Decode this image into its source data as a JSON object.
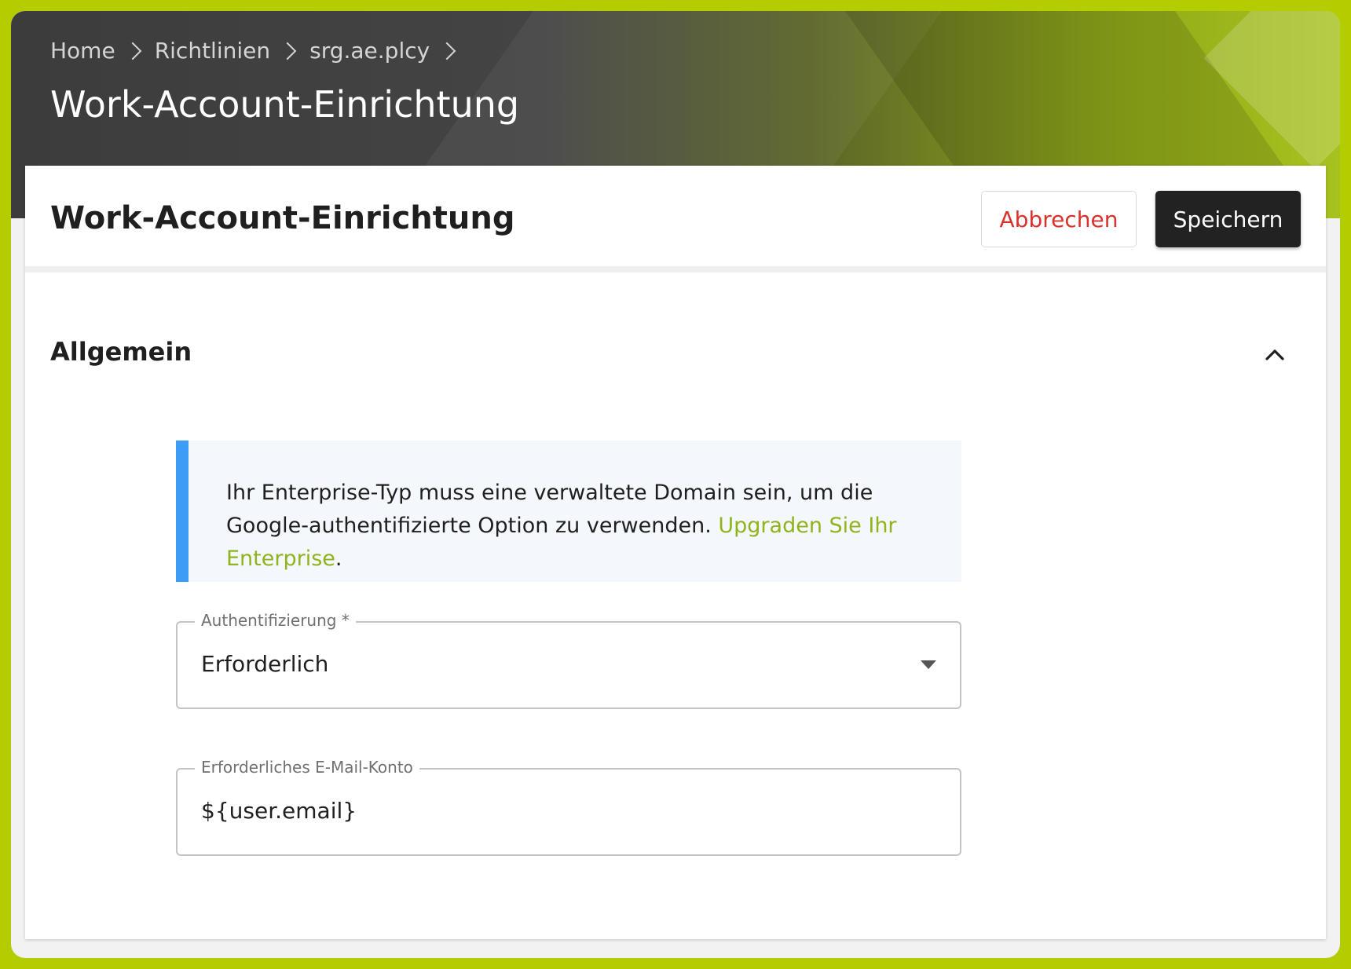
{
  "breadcrumb": {
    "items": [
      "Home",
      "Richtlinien",
      "srg.ae.plcy"
    ]
  },
  "page": {
    "title": "Work-Account-Einrichtung"
  },
  "card": {
    "title": "Work-Account-Einrichtung",
    "cancel_label": "Abbrechen",
    "save_label": "Speichern"
  },
  "section": {
    "title": "Allgemein",
    "expanded": true
  },
  "alert": {
    "text": "Ihr Enterprise-Typ muss eine verwaltete Domain sein, um die Google-authentifizierte Option zu verwenden.",
    "link_text": "Upgraden Sie Ihr Enterprise",
    "suffix": "."
  },
  "fields": {
    "authentication": {
      "label": "Authentifizierung *",
      "value": "Erforderlich"
    },
    "required_email": {
      "label": "Erforderliches E-Mail-Konto",
      "value": "${user.email}"
    }
  },
  "colors": {
    "accent": "#b3cd00",
    "alert_border": "#3d9cf5",
    "link": "#8fb41d",
    "cancel_text": "#d9312b",
    "primary_button": "#222222"
  }
}
